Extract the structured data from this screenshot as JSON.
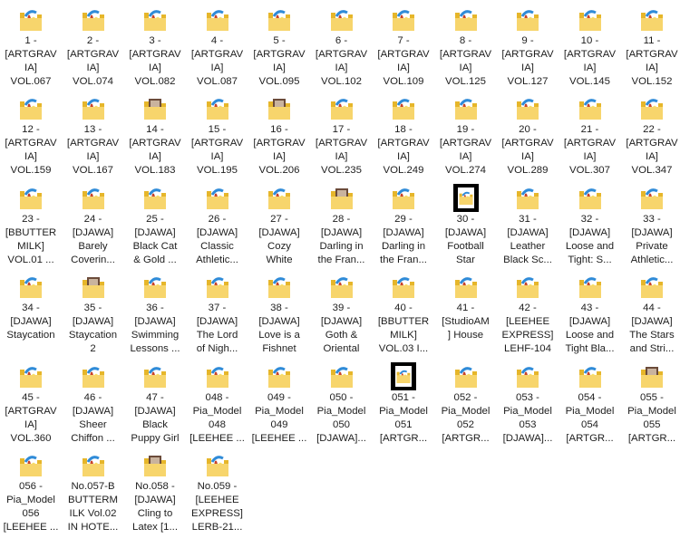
{
  "colors": {
    "folder_back": "#e6b62a",
    "folder_front": "#f7d56c",
    "paper_blue": "#2f8bd8",
    "paper_red": "#c8442a",
    "paper_yellow": "#f5e36b",
    "thumb_black": "#000000"
  },
  "items": [
    {
      "label": "1 -\n[ARTGRAV\nIA]\nVOL.067",
      "icon": "folder-icon"
    },
    {
      "label": "2 -\n[ARTGRAV\nIA]\nVOL.074",
      "icon": "folder-icon"
    },
    {
      "label": "3 -\n[ARTGRAV\nIA]\nVOL.082",
      "icon": "folder-icon"
    },
    {
      "label": "4 -\n[ARTGRAV\nIA]\nVOL.087",
      "icon": "folder-icon"
    },
    {
      "label": "5 -\n[ARTGRAV\nIA]\nVOL.095",
      "icon": "folder-icon"
    },
    {
      "label": "6 -\n[ARTGRAV\nIA]\nVOL.102",
      "icon": "folder-icon"
    },
    {
      "label": "7 -\n[ARTGRAV\nIA]\nVOL.109",
      "icon": "folder-icon"
    },
    {
      "label": "8 -\n[ARTGRAV\nIA]\nVOL.125",
      "icon": "folder-icon"
    },
    {
      "label": "9 -\n[ARTGRAV\nIA]\nVOL.127",
      "icon": "folder-icon"
    },
    {
      "label": "10 -\n[ARTGRAV\nIA]\nVOL.145",
      "icon": "folder-icon"
    },
    {
      "label": "11 -\n[ARTGRAV\nIA]\nVOL.152",
      "icon": "folder-icon"
    },
    {
      "label": "12 -\n[ARTGRAV\nIA]\nVOL.159",
      "icon": "folder-icon"
    },
    {
      "label": "13 -\n[ARTGRAV\nIA]\nVOL.167",
      "icon": "folder-icon"
    },
    {
      "label": "14 -\n[ARTGRAV\nIA]\nVOL.183",
      "icon": "photo-folder-icon"
    },
    {
      "label": "15 -\n[ARTGRAV\nIA]\nVOL.195",
      "icon": "folder-icon"
    },
    {
      "label": "16 -\n[ARTGRAV\nIA]\nVOL.206",
      "icon": "photo-folder-icon"
    },
    {
      "label": "17 -\n[ARTGRAV\nIA]\nVOL.235",
      "icon": "folder-icon"
    },
    {
      "label": "18 -\n[ARTGRAV\nIA]\nVOL.249",
      "icon": "folder-icon"
    },
    {
      "label": "19 -\n[ARTGRAV\nIA]\nVOL.274",
      "icon": "folder-icon"
    },
    {
      "label": "20 -\n[ARTGRAV\nIA]\nVOL.289",
      "icon": "folder-icon"
    },
    {
      "label": "21 -\n[ARTGRAV\nIA]\nVOL.307",
      "icon": "folder-icon"
    },
    {
      "label": "22 -\n[ARTGRAV\nIA]\nVOL.347",
      "icon": "folder-icon"
    },
    {
      "label": "23 -\n[BBUTTER\nMILK]\nVOL.01 ...",
      "icon": "folder-icon"
    },
    {
      "label": "24 -\n[DJAWA]\nBarely\nCoverin...",
      "icon": "folder-icon"
    },
    {
      "label": "25 -\n[DJAWA]\nBlack Cat\n& Gold ...",
      "icon": "folder-icon"
    },
    {
      "label": "26 -\n[DJAWA]\nClassic\nAthletic...",
      "icon": "folder-icon"
    },
    {
      "label": "27 -\n[DJAWA]\nCozy\nWhite",
      "icon": "folder-icon"
    },
    {
      "label": "28 -\n[DJAWA]\nDarling in\nthe Fran...",
      "icon": "photo-folder-icon"
    },
    {
      "label": "29 -\n[DJAWA]\nDarling in\nthe Fran...",
      "icon": "folder-icon"
    },
    {
      "label": "30 -\n[DJAWA]\nFootball\nStar",
      "icon": "black-thumbnail-icon"
    },
    {
      "label": "31 -\n[DJAWA]\nLeather\nBlack Sc...",
      "icon": "folder-icon"
    },
    {
      "label": "32 -\n[DJAWA]\nLoose and\nTight: S...",
      "icon": "folder-icon"
    },
    {
      "label": "33 -\n[DJAWA]\nPrivate\nAthletic...",
      "icon": "folder-icon"
    },
    {
      "label": "34 -\n[DJAWA]\nStaycation",
      "icon": "folder-icon"
    },
    {
      "label": "35 -\n[DJAWA]\nStaycation\n2",
      "icon": "photo-folder-icon"
    },
    {
      "label": "36 -\n[DJAWA]\nSwimming\nLessons ...",
      "icon": "folder-icon"
    },
    {
      "label": "37 -\n[DJAWA]\nThe Lord\nof Nigh...",
      "icon": "folder-icon"
    },
    {
      "label": "38 -\n[DJAWA]\nLove is a\nFishnet",
      "icon": "folder-icon"
    },
    {
      "label": "39 -\n[DJAWA]\nGoth &\nOriental",
      "icon": "folder-icon"
    },
    {
      "label": "40 -\n[BBUTTER\nMILK]\nVOL.03 I...",
      "icon": "folder-icon"
    },
    {
      "label": "41 -\n[StudioAM\n] House",
      "icon": "folder-icon"
    },
    {
      "label": "42 -\n[LEEHEE\nEXPRESS]\nLEHF-104",
      "icon": "folder-icon"
    },
    {
      "label": "43 -\n[DJAWA]\nLoose and\nTight Bla...",
      "icon": "folder-icon"
    },
    {
      "label": "44 -\n[DJAWA]\nThe Stars\nand Stri...",
      "icon": "folder-icon"
    },
    {
      "label": "45 -\n[ARTGRAV\nIA]\nVOL.360",
      "icon": "folder-icon"
    },
    {
      "label": "46 -\n[DJAWA]\nSheer\nChiffon ...",
      "icon": "folder-icon"
    },
    {
      "label": "47 -\n[DJAWA]\nBlack\nPuppy Girl",
      "icon": "folder-icon"
    },
    {
      "label": "048 -\nPia_Model\n048\n[LEEHEE ...",
      "icon": "folder-icon"
    },
    {
      "label": "049 -\nPia_Model\n049\n[LEEHEE ...",
      "icon": "folder-icon"
    },
    {
      "label": "050 -\nPia_Model\n050\n[DJAWA]...",
      "icon": "folder-icon"
    },
    {
      "label": "051 -\nPia_Model\n051\n[ARTGR...",
      "icon": "black-thumbnail-icon"
    },
    {
      "label": "052 -\nPia_Model\n052\n[ARTGR...",
      "icon": "folder-icon"
    },
    {
      "label": "053 -\nPia_Model\n053\n[DJAWA]...",
      "icon": "folder-icon"
    },
    {
      "label": "054 -\nPia_Model\n054\n[ARTGR...",
      "icon": "folder-icon"
    },
    {
      "label": "055 -\nPia_Model\n055\n[ARTGR...",
      "icon": "photo-folder-icon"
    },
    {
      "label": "056 -\nPia_Model\n056\n[LEEHEE ...",
      "icon": "folder-icon"
    },
    {
      "label": "No.057-B\nBUTTERM\nILK Vol.02\nIN HOTE...",
      "icon": "folder-icon"
    },
    {
      "label": "No.058 -\n[DJAWA]\nCling to\nLatex [1...",
      "icon": "photo-folder-icon"
    },
    {
      "label": "No.059 -\n[LEEHEE\nEXPRESS]\nLERB-21...",
      "icon": "folder-icon"
    }
  ]
}
